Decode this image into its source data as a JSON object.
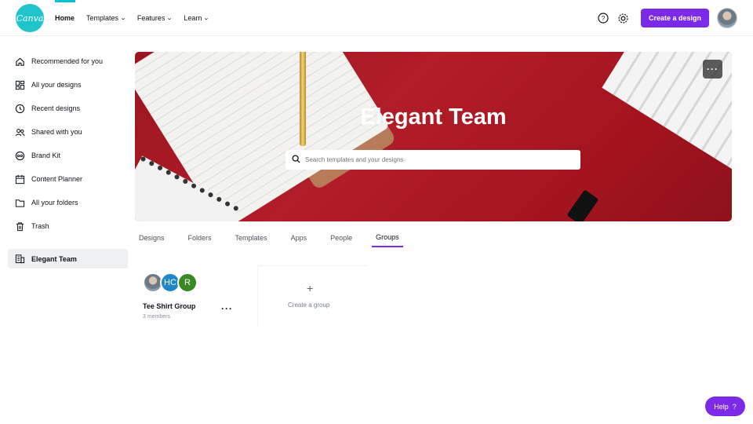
{
  "header": {
    "logo_text": "Canva",
    "nav": [
      {
        "label": "Home",
        "active": true,
        "dropdown": false
      },
      {
        "label": "Templates",
        "dropdown": true
      },
      {
        "label": "Features",
        "dropdown": true
      },
      {
        "label": "Learn",
        "dropdown": true
      }
    ],
    "create_label": "Create a design",
    "help_icon": "question-circle-icon",
    "settings_icon": "gear-icon"
  },
  "sidebar": {
    "items": [
      {
        "label": "Recommended for you",
        "icon": "home-icon"
      },
      {
        "label": "All your designs",
        "icon": "grid-icon"
      },
      {
        "label": "Recent designs",
        "icon": "clock-icon"
      },
      {
        "label": "Shared with you",
        "icon": "shared-users-icon"
      },
      {
        "label": "Brand Kit",
        "icon": "brand-kit-icon"
      },
      {
        "label": "Content Planner",
        "icon": "calendar-icon"
      },
      {
        "label": "All your folders",
        "icon": "folder-icon"
      },
      {
        "label": "Trash",
        "icon": "trash-icon"
      }
    ],
    "team": {
      "label": "Elegant Team",
      "icon": "building-icon"
    }
  },
  "banner": {
    "title": "Elegant Team",
    "search_placeholder": "Search templates and your designs"
  },
  "tabs": [
    {
      "label": "Designs"
    },
    {
      "label": "Folders"
    },
    {
      "label": "Templates"
    },
    {
      "label": "Apps"
    },
    {
      "label": "People"
    },
    {
      "label": "Groups",
      "active": true
    }
  ],
  "groups": [
    {
      "name": "Tee Shirt Group",
      "members": "3 members",
      "avatars": [
        "",
        "HC",
        "R"
      ]
    }
  ],
  "create_group_label": "Create a group",
  "help_label": "Help",
  "help_glyph": "?",
  "colors": {
    "brand_purple": "#7d2ae8",
    "logo_teal": "#20c4cb",
    "banner_red": "#a4141f"
  }
}
